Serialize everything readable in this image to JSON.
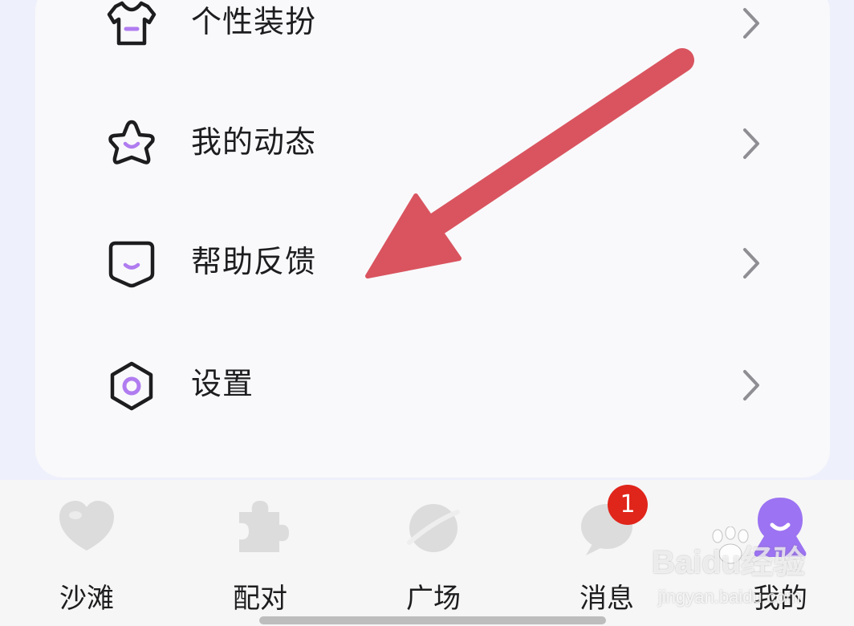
{
  "menu": {
    "items": [
      {
        "label": "个性装扮",
        "icon": "tshirt-icon"
      },
      {
        "label": "我的动态",
        "icon": "star-icon"
      },
      {
        "label": "帮助反馈",
        "icon": "feedback-icon"
      },
      {
        "label": "设置",
        "icon": "hexagon-settings-icon"
      }
    ]
  },
  "tabs": [
    {
      "label": "沙滩",
      "icon": "heart-icon"
    },
    {
      "label": "配对",
      "icon": "puzzle-icon"
    },
    {
      "label": "广场",
      "icon": "planet-icon"
    },
    {
      "label": "消息",
      "icon": "chat-bubble-icon",
      "badge": "1"
    },
    {
      "label": "我的",
      "icon": "profile-icon",
      "active": true
    }
  ],
  "watermark": {
    "brand": "Baidu经验",
    "url": "jingyan.baidu.com"
  },
  "colors": {
    "accent": "#b07cf0",
    "active_tab": "#9c73f2",
    "inactive_icon": "#d9d9d9",
    "badge": "#e0251b",
    "arrow": "#d9545f",
    "text": "#1d1d1f",
    "chevron": "#8e8e93"
  }
}
